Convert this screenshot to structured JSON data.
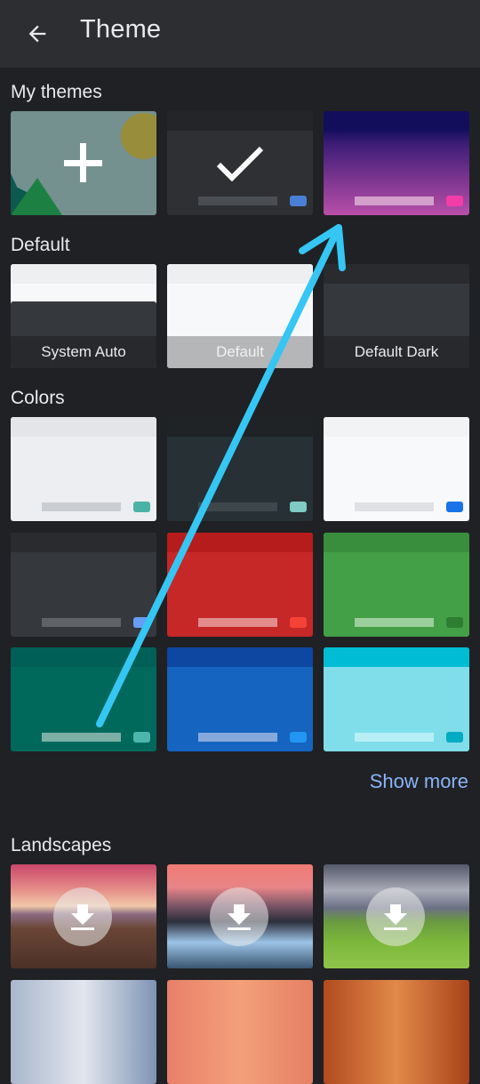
{
  "header": {
    "title": "Theme",
    "back_icon": "arrow-left-icon"
  },
  "sections": {
    "my_themes": {
      "title": "My themes",
      "tiles": [
        {
          "name": "add-custom-theme",
          "icon": "plus-icon"
        },
        {
          "name": "current-dark-theme",
          "icon": "checkmark-icon",
          "selected": true,
          "accent": "#4a7fd6"
        },
        {
          "name": "purple-gradient-theme",
          "accent": "#f23da8"
        }
      ]
    },
    "default": {
      "title": "Default",
      "tiles": [
        {
          "label": "System Auto"
        },
        {
          "label": "Default"
        },
        {
          "label": "Default Dark"
        }
      ]
    },
    "colors": {
      "title": "Colors",
      "tiles": [
        {
          "name": "light-grey",
          "top": "#e3e5e8",
          "body": "#eceef1",
          "bar": "#cacdd1",
          "accent": "#4bb3a5"
        },
        {
          "name": "dark-slate",
          "top": "#1f2326",
          "body": "#263035",
          "bar": "#3d474c",
          "accent": "#80cbc4"
        },
        {
          "name": "white",
          "top": "#f1f3f4",
          "body": "#f8f9fa",
          "bar": "#dfe1e5",
          "accent": "#1a73e8"
        },
        {
          "name": "dark-grey",
          "top": "#292b2f",
          "body": "#35383c",
          "bar": "#5f6368",
          "accent": "#669df6"
        },
        {
          "name": "red",
          "top": "#b71c1c",
          "body": "#c62828",
          "bar": "#e28c8c",
          "accent": "#f44336"
        },
        {
          "name": "green",
          "top": "#388e3c",
          "body": "#43a047",
          "bar": "#9ccf9e",
          "accent": "#2e7d32"
        },
        {
          "name": "teal",
          "top": "#005f56",
          "body": "#00695c",
          "bar": "#7cb0a6",
          "accent": "#4db6ac"
        },
        {
          "name": "blue",
          "top": "#0d47a1",
          "body": "#1565c0",
          "bar": "#86a9dc",
          "accent": "#2196f3"
        },
        {
          "name": "cyan",
          "top": "#00bcd4",
          "body": "#80deea",
          "bar": "#b8eef5",
          "accent": "#00acc1"
        }
      ]
    },
    "show_more": "Show more",
    "landscapes": {
      "title": "Landscapes",
      "tiles": [
        {
          "name": "beach-sunset",
          "icon": "download-icon"
        },
        {
          "name": "snowy-waterfall",
          "icon": "download-icon"
        },
        {
          "name": "green-hills-storm",
          "icon": "download-icon"
        }
      ]
    }
  },
  "annotation": {
    "type": "arrow",
    "color": "#35c6f4"
  }
}
